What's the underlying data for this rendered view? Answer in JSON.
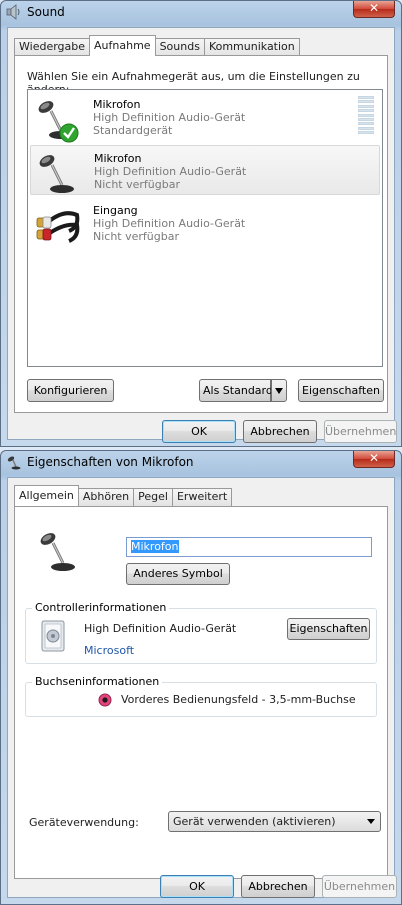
{
  "sound_window": {
    "title": "Sound",
    "close_label": "✕",
    "tabs": [
      {
        "label": "Wiedergabe",
        "active": false
      },
      {
        "label": "Aufnahme",
        "active": true
      },
      {
        "label": "Sounds",
        "active": false
      },
      {
        "label": "Kommunikation",
        "active": false
      }
    ],
    "instruction": "Wählen Sie ein Aufnahmegerät aus, um die Einstellungen zu ändern:",
    "devices": [
      {
        "name": "Mikrofon",
        "driver": "High Definition Audio-Gerät",
        "status": "Standardgerät",
        "icon": "microphone-default-icon",
        "selected": false
      },
      {
        "name": "Mikrofon",
        "driver": "High Definition Audio-Gerät",
        "status": "Nicht verfügbar",
        "icon": "microphone-icon",
        "selected": true
      },
      {
        "name": "Eingang",
        "driver": "High Definition Audio-Gerät",
        "status": "Nicht verfügbar",
        "icon": "rca-cable-icon",
        "selected": false
      }
    ],
    "buttons": {
      "configure": "Konfigurieren",
      "set_default": "Als Standard",
      "properties": "Eigenschaften",
      "ok": "OK",
      "cancel": "Abbrechen",
      "apply": "Übernehmen"
    }
  },
  "props_window": {
    "title": "Eigenschaften von Mikrofon",
    "close_label": "✕",
    "tabs": [
      {
        "label": "Allgemein",
        "active": true
      },
      {
        "label": "Abhören",
        "active": false
      },
      {
        "label": "Pegel",
        "active": false
      },
      {
        "label": "Erweitert",
        "active": false
      }
    ],
    "device_name": "Mikrofon",
    "change_icon_button": "Anderes Symbol",
    "controller": {
      "group_title": "Controllerinformationen",
      "name": "High Definition Audio-Gerät",
      "vendor": "Microsoft",
      "properties_button": "Eigenschaften"
    },
    "jack": {
      "group_title": "Buchseninformationen",
      "description": "Vorderes Bedienungsfeld - 3,5-mm-Buchse"
    },
    "usage": {
      "label": "Geräteverwendung:",
      "selected": "Gerät verwenden (aktivieren)"
    },
    "buttons": {
      "ok": "OK",
      "cancel": "Abbrechen",
      "apply": "Übernehmen"
    }
  },
  "colors": {
    "accent": "#3399ff",
    "vendor_link": "#1f57a8",
    "jack_pink": "#e0457b",
    "check_green": "#2fa52f"
  }
}
